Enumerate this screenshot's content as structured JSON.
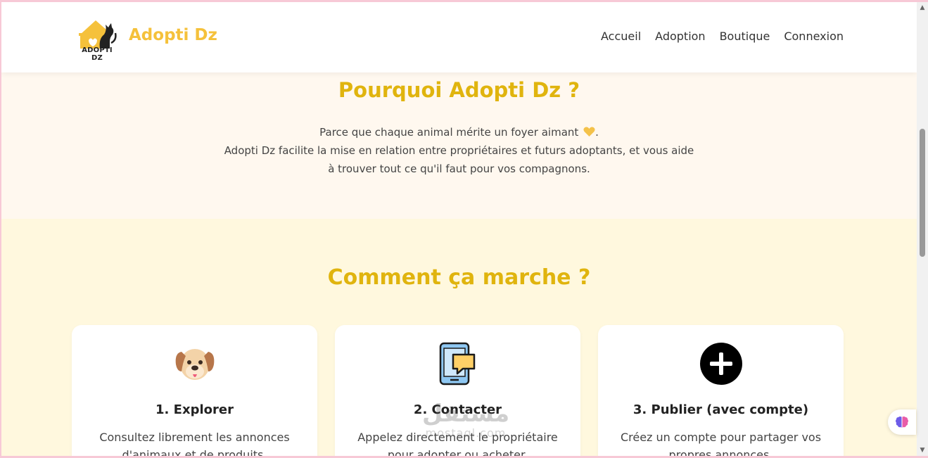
{
  "header": {
    "brand": "Adopti Dz",
    "logo_text": "ADOPTI DZ",
    "nav": [
      "Accueil",
      "Adoption",
      "Boutique",
      "Connexion"
    ]
  },
  "why": {
    "title": "Pourquoi Adopti Dz ?",
    "line1": "Parce que chaque animal mérite un foyer aimant",
    "line1_end": ".",
    "line2": "Adopti Dz facilite la mise en relation entre propriétaires et futurs adoptants, et vous aide",
    "line3": "à trouver tout ce qu'il faut pour vos compagnons."
  },
  "how": {
    "title": "Comment ça marche ?",
    "cards": [
      {
        "icon": "dog-face-icon",
        "title": "1. Explorer",
        "desc": "Consultez librement les annonces d'animaux et de produits."
      },
      {
        "icon": "phone-chat-icon",
        "title": "2. Contacter",
        "desc": "Appelez directement le propriétaire pour adopter ou acheter."
      },
      {
        "icon": "plus-circle-icon",
        "title": "3. Publier (avec compte)",
        "desc": "Créez un compte pour partager vos propres annonces."
      }
    ]
  },
  "watermark": {
    "arabic": "مستقل",
    "latin": "mostaql.com"
  },
  "colors": {
    "accent": "#e0b40e",
    "brand": "#f5c13b",
    "section1_bg": "#fff8ef",
    "section2_bg": "#fff8de"
  }
}
